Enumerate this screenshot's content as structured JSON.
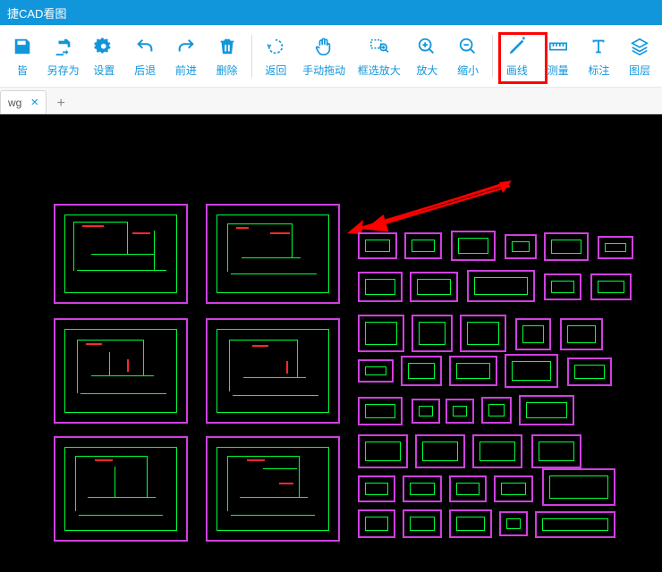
{
  "title": "捷CAD看图",
  "toolbar": {
    "save_label": "皆",
    "saveas_label": "另存为",
    "settings_label": "设置",
    "back_label": "后退",
    "forward_label": "前进",
    "delete_label": "删除",
    "return_label": "返回",
    "pan_label": "手动拖动",
    "window_zoom_label": "框选放大",
    "zoomin_label": "放大",
    "zoomout_label": "缩小",
    "line_label": "画线",
    "measure_label": "测量",
    "annotate_label": "标注",
    "layers_label": "图层"
  },
  "tab": {
    "name": "wg",
    "close": "×",
    "add": "+"
  },
  "colors": {
    "accent": "#1296db",
    "cad_green": "#00ff3c",
    "cad_magenta": "#d040e0",
    "cad_red": "#ff2a2a",
    "highlight": "#ff0000"
  }
}
